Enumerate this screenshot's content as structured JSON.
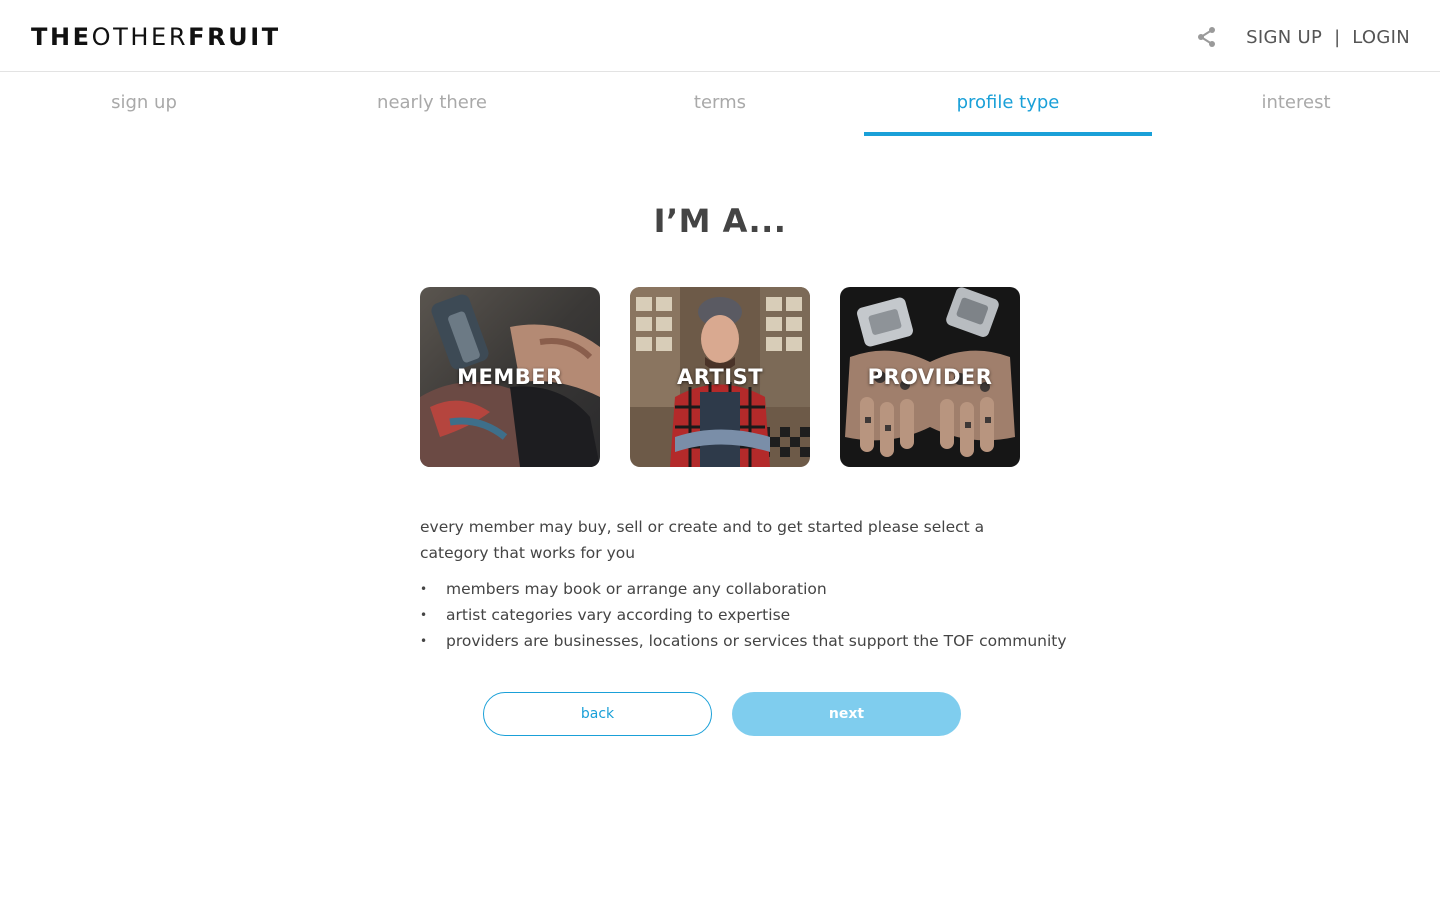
{
  "header": {
    "logo_bold_1": "THE",
    "logo_light": "OTHER",
    "logo_bold_2": "FRUIT",
    "share_icon": "share-icon",
    "signup_label": "SIGN UP",
    "separator": "|",
    "login_label": "LOGIN"
  },
  "tabs": [
    {
      "label": "sign up",
      "active": false
    },
    {
      "label": "nearly there",
      "active": false
    },
    {
      "label": "terms",
      "active": false
    },
    {
      "label": "profile type",
      "active": true
    },
    {
      "label": "interest",
      "active": false
    }
  ],
  "title": "I’M A...",
  "cards": [
    {
      "label": "MEMBER"
    },
    {
      "label": "ARTIST"
    },
    {
      "label": "PROVIDER"
    }
  ],
  "description": "every member may buy, sell or create and to get started please select a category that works for you",
  "bullets": [
    "members may book or arrange any collaboration",
    "artist categories vary according to expertise",
    "providers are businesses, locations or services that support the TOF community"
  ],
  "bullet_glyph": "•",
  "buttons": {
    "back_label": "back",
    "next_label": "next"
  },
  "colors": {
    "accent": "#1aa0d8",
    "next_button": "#7fcdee",
    "inactive_tab": "#a9a9a9"
  }
}
